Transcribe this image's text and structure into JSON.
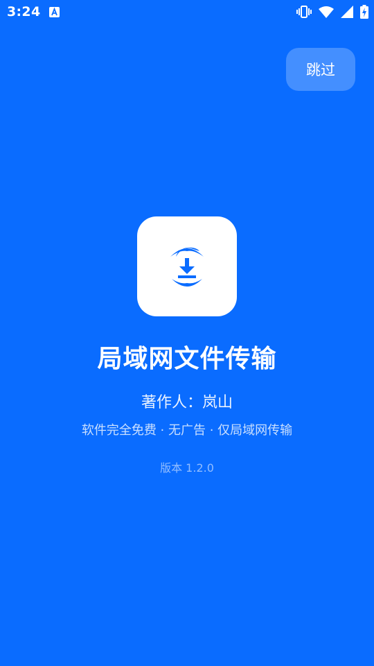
{
  "status_bar": {
    "time": "3:24",
    "icons": [
      "notification-a-icon",
      "vibrate-icon",
      "wifi-icon",
      "cell-signal-icon",
      "battery-charging-icon"
    ]
  },
  "skip_button": {
    "label": "跳过"
  },
  "app": {
    "icon": "download-icon",
    "title": "局域网文件传输",
    "author": "著作人：岚山",
    "tagline": "软件完全免费 · 无广告 · 仅局域网传输",
    "version": "版本 1.2.0"
  },
  "colors": {
    "background": "#0a6cff",
    "icon_bg": "#ffffff",
    "accent": "#0a6cff"
  }
}
